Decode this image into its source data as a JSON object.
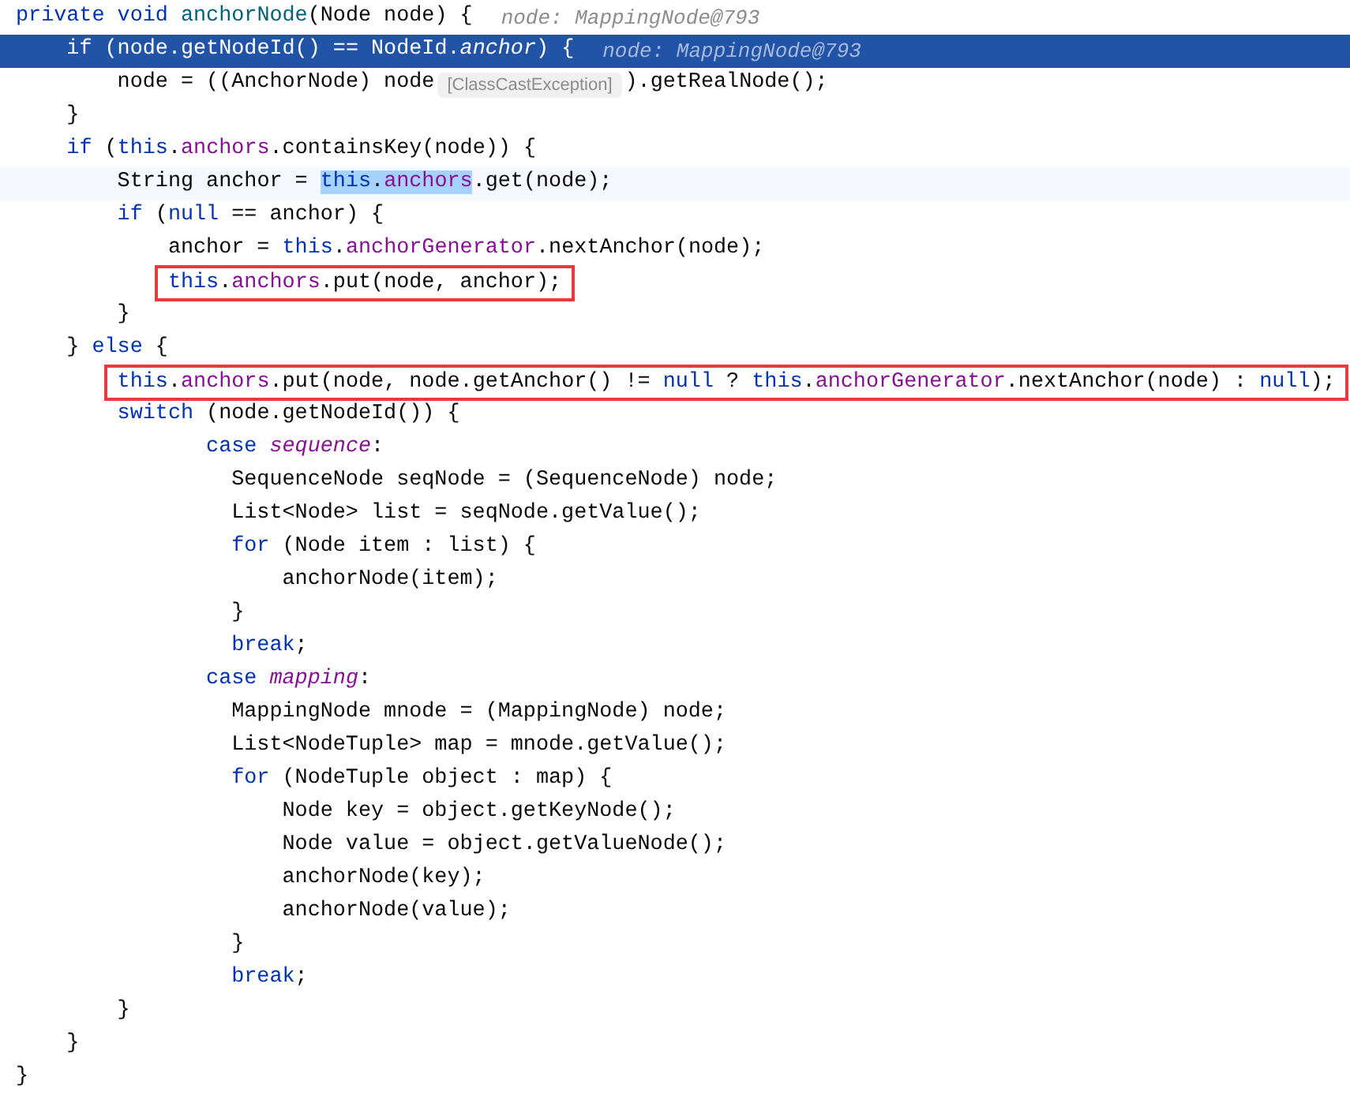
{
  "editor": {
    "lines": [
      {
        "kind": "plain",
        "hint": "node: MappingNode@793",
        "tokens": [
          {
            "kind": "keyword",
            "text": "private "
          },
          {
            "kind": "keyword",
            "text": "void "
          },
          {
            "kind": "method",
            "text": "anchorNode"
          },
          {
            "kind": "text",
            "text": "(Node node) {"
          }
        ]
      },
      {
        "kind": "execution",
        "hint": "node: MappingNode@793",
        "tokens": [
          {
            "kind": "keyword",
            "text": "    if"
          },
          {
            "kind": "text",
            "text": " (node.getNodeId() == NodeId."
          },
          {
            "kind": "static",
            "text": "anchor"
          },
          {
            "kind": "text",
            "text": ") {"
          }
        ]
      },
      {
        "kind": "plain",
        "tokens": [
          {
            "kind": "text",
            "text": "        node = ((AnchorNode) node"
          },
          {
            "kind": "badge",
            "text": "[ClassCastException]"
          },
          {
            "kind": "text",
            "text": ").getRealNode();"
          }
        ]
      },
      {
        "kind": "plain",
        "tokens": [
          {
            "kind": "text",
            "text": "    }"
          }
        ]
      },
      {
        "kind": "plain",
        "tokens": [
          {
            "kind": "keyword",
            "text": "    if"
          },
          {
            "kind": "text",
            "text": " ("
          },
          {
            "kind": "keyword",
            "text": "this"
          },
          {
            "kind": "text",
            "text": "."
          },
          {
            "kind": "field",
            "text": "anchors"
          },
          {
            "kind": "text",
            "text": ".containsKey(node)) {"
          }
        ]
      },
      {
        "kind": "caret",
        "tokens": [
          {
            "kind": "text",
            "text": "        String anchor = "
          },
          {
            "kind": "selected-keyword",
            "text": "this"
          },
          {
            "kind": "selected-text",
            "text": "."
          },
          {
            "kind": "selected-field",
            "text": "anchors"
          },
          {
            "kind": "text",
            "text": ".get(node);"
          }
        ]
      },
      {
        "kind": "plain",
        "tokens": [
          {
            "kind": "keyword",
            "text": "        if"
          },
          {
            "kind": "text",
            "text": " ("
          },
          {
            "kind": "keyword",
            "text": "null"
          },
          {
            "kind": "text",
            "text": " == anchor) {"
          }
        ]
      },
      {
        "kind": "plain",
        "tokens": [
          {
            "kind": "text",
            "text": "            anchor = "
          },
          {
            "kind": "keyword",
            "text": "this"
          },
          {
            "kind": "text",
            "text": "."
          },
          {
            "kind": "field",
            "text": "anchorGenerator"
          },
          {
            "kind": "text",
            "text": ".nextAnchor(node);"
          }
        ]
      },
      {
        "kind": "boxed",
        "tokens": [
          {
            "kind": "keyword",
            "text": "            this"
          },
          {
            "kind": "text",
            "text": "."
          },
          {
            "kind": "field",
            "text": "anchors"
          },
          {
            "kind": "text",
            "text": ".put(node, anchor);"
          }
        ]
      },
      {
        "kind": "plain",
        "tokens": [
          {
            "kind": "text",
            "text": "        }"
          }
        ]
      },
      {
        "kind": "plain",
        "tokens": [
          {
            "kind": "text",
            "text": "    } "
          },
          {
            "kind": "keyword",
            "text": "else"
          },
          {
            "kind": "text",
            "text": " {"
          }
        ]
      },
      {
        "kind": "boxed",
        "tokens": [
          {
            "kind": "keyword",
            "text": "        this"
          },
          {
            "kind": "text",
            "text": "."
          },
          {
            "kind": "field",
            "text": "anchors"
          },
          {
            "kind": "text",
            "text": ".put(node, node.getAnchor() != "
          },
          {
            "kind": "keyword",
            "text": "null"
          },
          {
            "kind": "text",
            "text": " ? "
          },
          {
            "kind": "keyword",
            "text": "this"
          },
          {
            "kind": "text",
            "text": "."
          },
          {
            "kind": "field",
            "text": "anchorGenerator"
          },
          {
            "kind": "text",
            "text": ".nextAnchor(node) : "
          },
          {
            "kind": "keyword",
            "text": "null"
          },
          {
            "kind": "text",
            "text": ");"
          }
        ]
      },
      {
        "kind": "plain",
        "tokens": [
          {
            "kind": "keyword",
            "text": "        switch"
          },
          {
            "kind": "text",
            "text": " (node.getNodeId()) {"
          }
        ]
      },
      {
        "kind": "plain",
        "tokens": [
          {
            "kind": "keyword",
            "text": "               case "
          },
          {
            "kind": "static",
            "text": "sequence"
          },
          {
            "kind": "text",
            "text": ":"
          }
        ]
      },
      {
        "kind": "plain",
        "tokens": [
          {
            "kind": "text",
            "text": "                 SequenceNode seqNode = (SequenceNode) node;"
          }
        ]
      },
      {
        "kind": "plain",
        "tokens": [
          {
            "kind": "text",
            "text": "                 List<Node> list = seqNode.getValue();"
          }
        ]
      },
      {
        "kind": "plain",
        "tokens": [
          {
            "kind": "keyword",
            "text": "                 for"
          },
          {
            "kind": "text",
            "text": " (Node item : list) {"
          }
        ]
      },
      {
        "kind": "plain",
        "tokens": [
          {
            "kind": "text",
            "text": "                     anchorNode(item);"
          }
        ]
      },
      {
        "kind": "plain",
        "tokens": [
          {
            "kind": "text",
            "text": "                 }"
          }
        ]
      },
      {
        "kind": "plain",
        "tokens": [
          {
            "kind": "keyword",
            "text": "                 break"
          },
          {
            "kind": "text",
            "text": ";"
          }
        ]
      },
      {
        "kind": "plain",
        "tokens": [
          {
            "kind": "keyword",
            "text": "               case "
          },
          {
            "kind": "static",
            "text": "mapping"
          },
          {
            "kind": "text",
            "text": ":"
          }
        ]
      },
      {
        "kind": "plain",
        "tokens": [
          {
            "kind": "text",
            "text": "                 MappingNode mnode = (MappingNode) node;"
          }
        ]
      },
      {
        "kind": "plain",
        "tokens": [
          {
            "kind": "text",
            "text": "                 List<NodeTuple> map = mnode.getValue();"
          }
        ]
      },
      {
        "kind": "plain",
        "tokens": [
          {
            "kind": "keyword",
            "text": "                 for"
          },
          {
            "kind": "text",
            "text": " (NodeTuple object : map) {"
          }
        ]
      },
      {
        "kind": "plain",
        "tokens": [
          {
            "kind": "text",
            "text": "                     Node key = object.getKeyNode();"
          }
        ]
      },
      {
        "kind": "plain",
        "tokens": [
          {
            "kind": "text",
            "text": "                     Node value = object.getValueNode();"
          }
        ]
      },
      {
        "kind": "plain",
        "tokens": [
          {
            "kind": "text",
            "text": "                     anchorNode(key);"
          }
        ]
      },
      {
        "kind": "plain",
        "tokens": [
          {
            "kind": "text",
            "text": "                     anchorNode(value);"
          }
        ]
      },
      {
        "kind": "plain",
        "tokens": [
          {
            "kind": "text",
            "text": "                 }"
          }
        ]
      },
      {
        "kind": "plain",
        "tokens": [
          {
            "kind": "keyword",
            "text": "                 break"
          },
          {
            "kind": "text",
            "text": ";"
          }
        ]
      },
      {
        "kind": "plain",
        "tokens": [
          {
            "kind": "text",
            "text": "        }"
          }
        ]
      },
      {
        "kind": "plain",
        "tokens": [
          {
            "kind": "text",
            "text": "    }"
          }
        ]
      },
      {
        "kind": "plain",
        "tokens": [
          {
            "kind": "text",
            "text": "}"
          }
        ]
      }
    ]
  }
}
